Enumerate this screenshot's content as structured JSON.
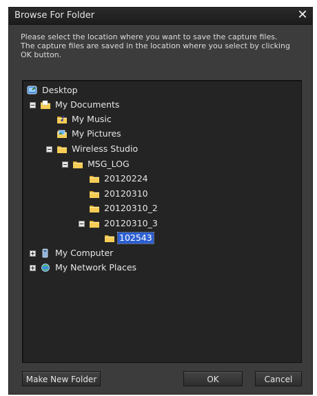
{
  "dialog": {
    "title": "Browse For Folder",
    "close_glyph": "✕",
    "description_lines": [
      "Please select the location where you want to save the capture files.",
      "The capture files are saved in the location where you select by clicking",
      "OK button."
    ]
  },
  "tree": {
    "desktop": "Desktop",
    "my_documents": "My Documents",
    "my_music": "My Music",
    "my_pictures": "My Pictures",
    "wireless_studio": "Wireless Studio",
    "msg_log": "MSG_LOG",
    "f1": "20120224",
    "f2": "20120310",
    "f3": "20120310_2",
    "f4": "20120310_3",
    "selected": "102543",
    "my_computer": "My Computer",
    "my_network_places": "My Network Places"
  },
  "buttons": {
    "make_new_folder": "Make New Folder",
    "ok": "OK",
    "cancel": "Cancel"
  },
  "colors": {
    "selection": "#2d5fd2",
    "folder": "#f2c24a"
  }
}
